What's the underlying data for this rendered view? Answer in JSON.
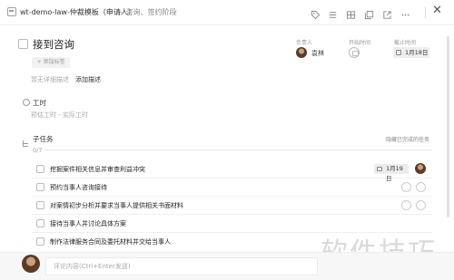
{
  "header": {
    "project": "wt-demo-law-仲裁模板（申请人）",
    "stage": "– 咨询、签约阶段"
  },
  "task": {
    "title": "接到咨询",
    "add_tag": "+ 添加标签",
    "description_empty": "暂无详细描述",
    "add_description": "添加描述"
  },
  "fields": {
    "owner_label": "负责人",
    "owner_name": "袁林",
    "start_label": "开始时间",
    "due_label": "截止时间",
    "due_value": "1月18日"
  },
  "worktime": {
    "label": "工时",
    "value": "预估工时 - 实际工时"
  },
  "subtasks": {
    "label": "子任务",
    "hide_completed": "隐藏已完成的任务",
    "count": "0/7",
    "progress": 0,
    "items": [
      {
        "title": "挖掘案件相关信息并审查利益冲突",
        "due": "1月19日",
        "has_owner": true
      },
      {
        "title": "预约当事人咨询接待"
      },
      {
        "title": "对案情初步分析并要求当事人提供相关书面材料"
      },
      {
        "title": "接待当事人并讨论具体方案"
      },
      {
        "title": "制作法律服务合同及委托材料并交给当事人"
      }
    ]
  },
  "comment": {
    "placeholder": "评论内容(Ctrl+Enter发送)"
  },
  "watermark": "软件技巧"
}
